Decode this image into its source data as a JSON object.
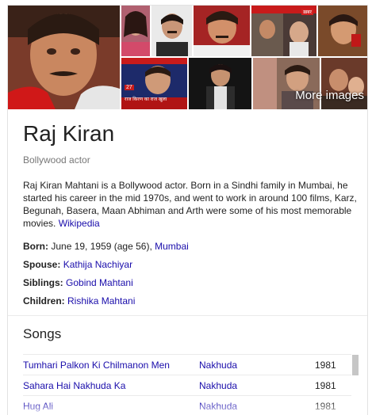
{
  "collage": {
    "more_images_label": "More images",
    "news_strip_text": "राज किरण का राज खुला",
    "news_badge": "27",
    "tv_tag": "ख़बर"
  },
  "entity": {
    "name": "Raj Kiran",
    "type": "Bollywood actor",
    "description": "Raj Kiran Mahtani is a Bollywood actor. Born in a Sindhi family in Mumbai, he started his career in the mid 1970s, and went to work in around 100 films, Karz, Begunah, Basera, Maan Abhiman and Arth were some of his most memorable movies.",
    "source_link": "Wikipedia"
  },
  "facts": {
    "born": {
      "label": "Born:",
      "value": "June 19, 1959 (age 56),",
      "link": "Mumbai"
    },
    "spouse": {
      "label": "Spouse:",
      "link": "Kathija Nachiyar"
    },
    "siblings": {
      "label": "Siblings:",
      "link": "Gobind Mahtani"
    },
    "children": {
      "label": "Children:",
      "link": "Rishika Mahtani"
    }
  },
  "songs": {
    "heading": "Songs",
    "rows": [
      {
        "song": "Tumhari Palkon Ki Chilmanon Men",
        "film": "Nakhuda",
        "year": "1981"
      },
      {
        "song": "Sahara Hai Nakhuda Ka",
        "film": "Nakhuda",
        "year": "1981"
      },
      {
        "song": "Hug Ali",
        "film": "Nakhuda",
        "year": "1981"
      }
    ]
  },
  "colors": {
    "link": "#1a0dab",
    "text": "#222222",
    "muted": "#777777"
  }
}
